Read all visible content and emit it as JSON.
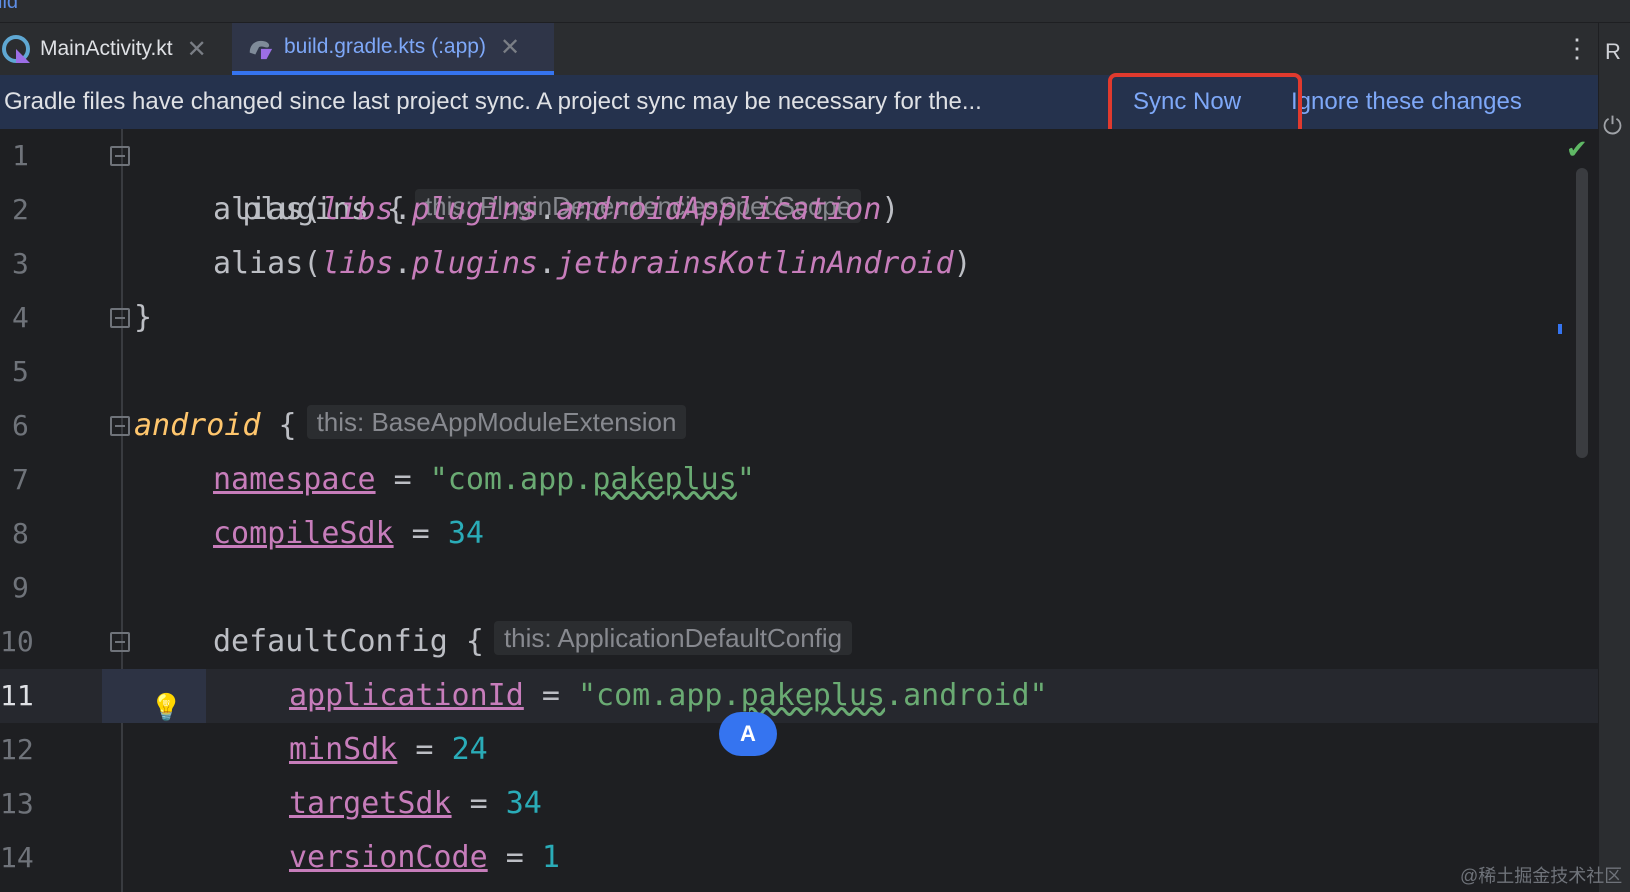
{
  "tabs": [
    {
      "label": "MainActivity.kt",
      "icon": "kotlin-file-icon",
      "active": false
    },
    {
      "label": "build.gradle.kts (:app)",
      "icon": "gradle-kotlin-icon",
      "active": true
    }
  ],
  "top_strip_fragment": "ild",
  "right_strip_label": "R",
  "banner": {
    "message": "Gradle files have changed since last project sync. A project sync may be necessary for the...",
    "sync_now": "Sync Now",
    "ignore": "Ignore these changes"
  },
  "line_numbers": [
    "1",
    "2",
    "3",
    "4",
    "5",
    "6",
    "7",
    "8",
    "9",
    "10",
    "11",
    "12",
    "13",
    "14"
  ],
  "code": {
    "l1_kw": "plugins {",
    "l1_hint": "this: PluginDependenciesSpecScope",
    "l2_alias": "alias(",
    "l2_libs": "libs",
    "l2_plugins": "plugins",
    "l2_name": "androidApplication",
    "l3_alias": "alias(",
    "l3_libs": "libs",
    "l3_plugins": "plugins",
    "l3_name": "jetbrainsKotlinAndroid",
    "l4_close": "}",
    "l6_android": "android",
    "l6_brace": " {",
    "l6_hint": "this: BaseAppModuleExtension",
    "l7_field": "namespace",
    "l7_eq": " = ",
    "l7_str_a": "\"com.app.",
    "l7_str_b": "pakeplus",
    "l7_str_c": "\"",
    "l8_field": "compileSdk",
    "l8_eq": " = ",
    "l8_num": "34",
    "l10_kw": "defaultConfig {",
    "l10_hint": "this: ApplicationDefaultConfig",
    "l11_field": "applicationId",
    "l11_eq": " = ",
    "l11_str_a": "\"com.app.",
    "l11_str_b": "pakeplus",
    "l11_str_c": ".android\"",
    "l12_field": "minSdk",
    "l12_eq": " = ",
    "l12_num": "24",
    "l13_field": "targetSdk",
    "l13_eq": " = ",
    "l13_num": "34",
    "l14_field": "versionCode",
    "l14_eq": " = ",
    "l14_num": "1"
  },
  "avatar_letter": "A",
  "watermark": "@稀土掘金技术社区",
  "colors": {
    "accent": "#3574f0",
    "link": "#7ea8f8",
    "highlight_box": "#e03a2e",
    "banner_bg": "#25324d",
    "editor_bg": "#1e1f22"
  }
}
